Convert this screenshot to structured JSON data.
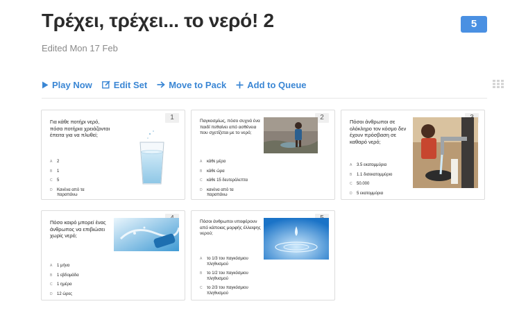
{
  "header": {
    "title": "Τρέχει, τρέχει... το νερό! 2",
    "question_count": "5",
    "edited": "Edited Mon 17 Feb"
  },
  "toolbar": {
    "play_now": "Play Now",
    "edit_set": "Edit Set",
    "move_to_pack": "Move to Pack",
    "add_to_queue": "Add to Queue"
  },
  "colors": {
    "accent": "#3a86d4",
    "badge": "#4a90e2"
  },
  "cards": [
    {
      "number": "1",
      "question": "Για κάθε ποτήρι νερό, πόσα ποτήρια χρειάζονται έπειτα για να πλυθεί;",
      "answers": [
        {
          "letter": "A",
          "text": "2"
        },
        {
          "letter": "B",
          "text": "1"
        },
        {
          "letter": "C",
          "text": "5"
        },
        {
          "letter": "D",
          "text": "Κανένα από τα παραπάνω"
        }
      ]
    },
    {
      "number": "2",
      "question": "Παγκοσμίως, πόσο συχνά ένα παιδί πεθαίνει από ασθένεια που σχετίζεται με το νερό;",
      "answers": [
        {
          "letter": "A",
          "text": "κάθε μέρα"
        },
        {
          "letter": "B",
          "text": "κάθε ώρα"
        },
        {
          "letter": "C",
          "text": "κάθε 15 δευτερόλεπτα"
        },
        {
          "letter": "D",
          "text": "κανένα από τα παραπάνω"
        }
      ]
    },
    {
      "number": "3",
      "question": "Πόσοι άνθρωποι σε ολόκληρο τον κόσμο δεν έχουν πρόσβαση σε καθαρό νερό;",
      "answers": [
        {
          "letter": "A",
          "text": "3.5 εκατομμύρια"
        },
        {
          "letter": "B",
          "text": "1.1 δισεκατομμύριο"
        },
        {
          "letter": "C",
          "text": "50.000"
        },
        {
          "letter": "D",
          "text": "5 εκατομμύρια"
        }
      ]
    },
    {
      "number": "4",
      "question": "Πόσο καιρό μπορεί ένας άνθρωπος να επιβιώσει χωρίς νερό;",
      "answers": [
        {
          "letter": "A",
          "text": "1 μήνα"
        },
        {
          "letter": "B",
          "text": "1 εβδομάδα"
        },
        {
          "letter": "C",
          "text": "1 ημέρα"
        },
        {
          "letter": "D",
          "text": "12 ώρες"
        }
      ]
    },
    {
      "number": "5",
      "question": "Πόσοι άνθρωποι υποφέρουν από κάποιας μορφής έλλειψης νερού;",
      "answers": [
        {
          "letter": "A",
          "text": "το 1/3 του παγκόσμιου πληθυσμού"
        },
        {
          "letter": "B",
          "text": "το 1/2 του παγκόσμιου πληθυσμού"
        },
        {
          "letter": "C",
          "text": "το 2/3 του παγκόσμιου πληθυσμού"
        }
      ]
    }
  ]
}
